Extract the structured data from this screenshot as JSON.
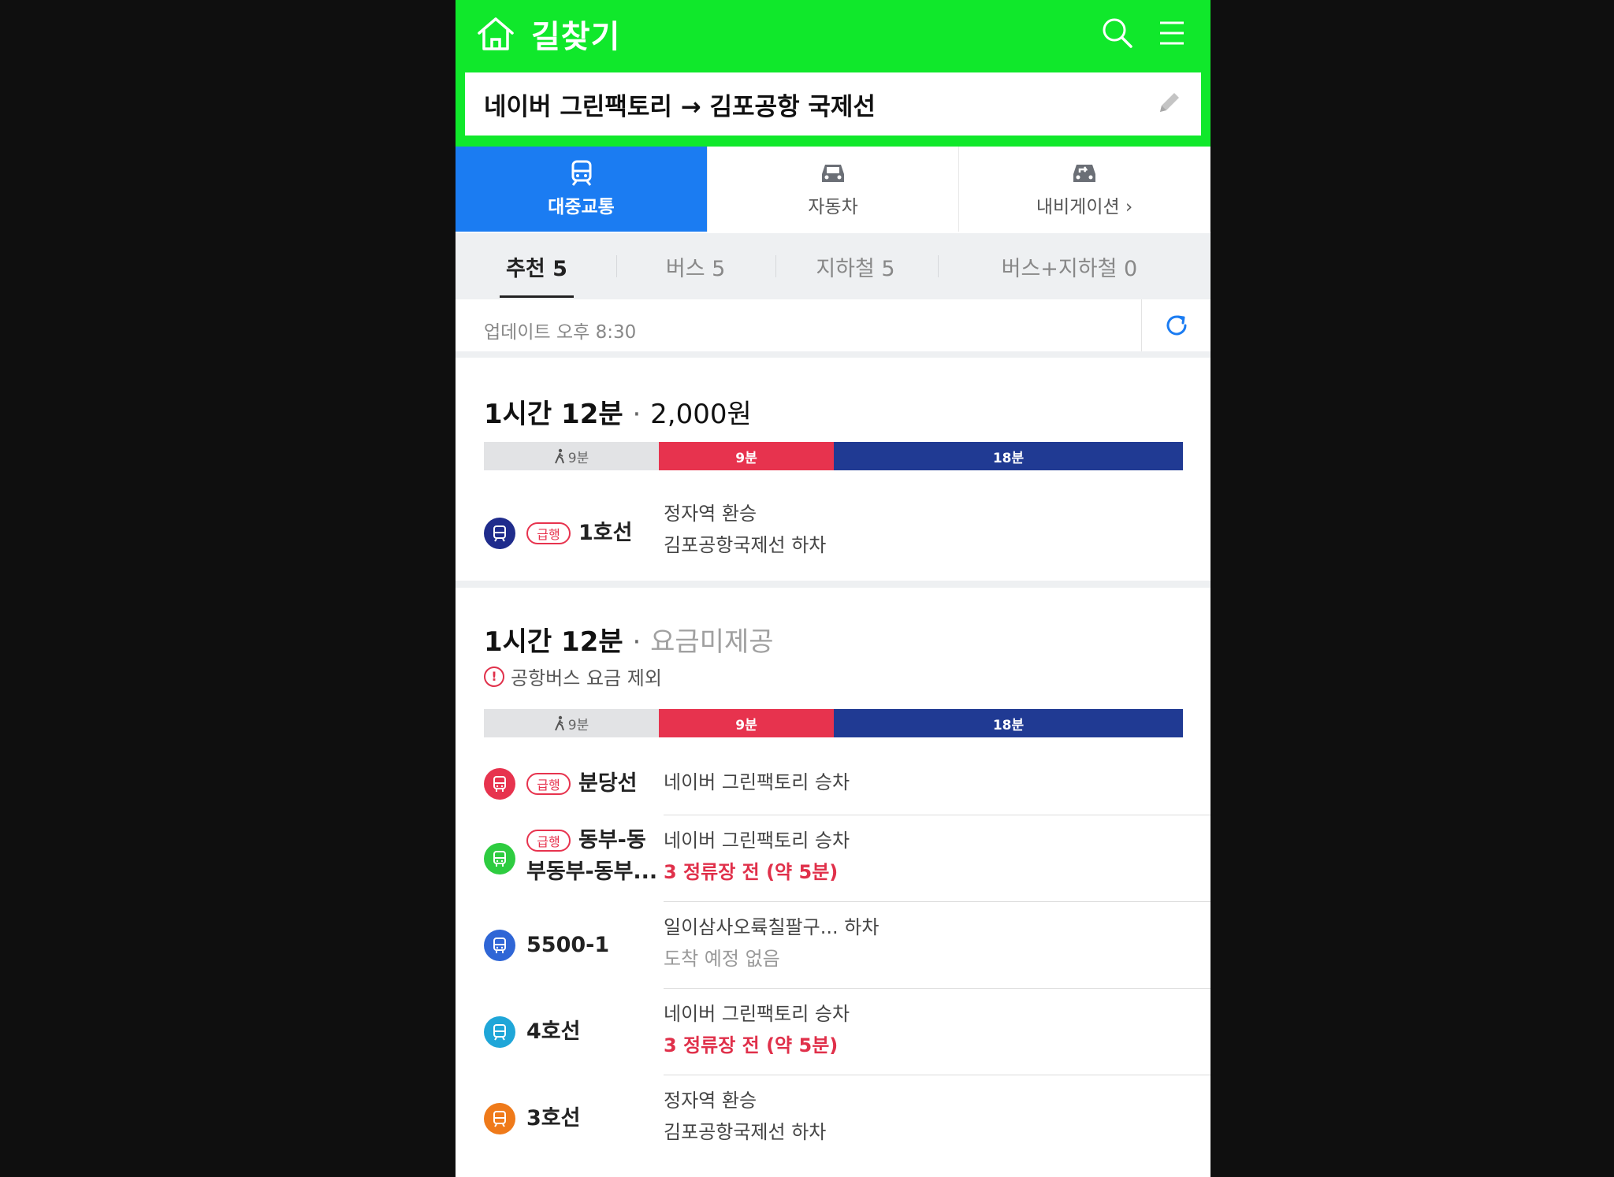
{
  "header": {
    "title": "길찾기",
    "route": "네이버 그린팩토리 → 김포공항 국제선",
    "colors": {
      "brand": "#10e82b"
    }
  },
  "mode_tabs": [
    {
      "label": "대중교통",
      "icon": "train-icon",
      "active": true
    },
    {
      "label": "자동차",
      "icon": "car-icon",
      "active": false
    },
    {
      "label": "내비게이션 ›",
      "icon": "navigation-car-icon",
      "active": false
    }
  ],
  "sub_tabs": [
    {
      "label": "추천 5",
      "active": true
    },
    {
      "label": "버스 5",
      "active": false
    },
    {
      "label": "지하철 5",
      "active": false
    },
    {
      "label": "버스+지하철 0",
      "active": false
    }
  ],
  "update": {
    "text": "업데이트 오후 8:30"
  },
  "routes": [
    {
      "duration": "1시간 12분",
      "separator": "·",
      "fare": "2,000원",
      "segments": [
        {
          "label": "9분",
          "type": "walk"
        },
        {
          "label": "9분",
          "type": "red"
        },
        {
          "label": "18분",
          "type": "blue"
        }
      ],
      "legs": [
        {
          "badge": "급행",
          "name": "1호선",
          "desc1": "정자역 환승",
          "desc2": "김포공항국제선 하차"
        }
      ]
    },
    {
      "duration": "1시간 12분",
      "separator": "·",
      "fare": "요금미제공",
      "notice": "공항버스 요금 제외",
      "segments": [
        {
          "label": "9분",
          "type": "walk"
        },
        {
          "label": "9분",
          "type": "red"
        },
        {
          "label": "18분",
          "type": "blue"
        }
      ],
      "legs": [
        {
          "badge": "급행",
          "name": "분당선",
          "desc1": "네이버 그린팩토리 승차"
        },
        {
          "badge": "급행",
          "name": "동부-동",
          "name2": "부동부-동부...",
          "desc1": "네이버 그린팩토리 승차",
          "desc2": "3 정류장 전 (약 5분)"
        },
        {
          "name": "5500-1",
          "desc1": "일이삼사오륙칠팔구...  하차",
          "desc2": "도착 예정 없음"
        },
        {
          "name": "4호선",
          "desc1": "네이버 그린팩토리 승차",
          "desc2": "3 정류장 전 (약 5분)"
        },
        {
          "name": "3호선",
          "desc1": "정자역 환승",
          "desc2": "김포공항국제선 하차"
        }
      ]
    }
  ],
  "line_colors": {
    "line1": "#1f2c8c",
    "bundang": "#e7334e",
    "green_bus": "#2ecc40",
    "blue_bus": "#2f66d6",
    "line4": "#1fa6d8",
    "line3": "#ef7a1a"
  }
}
